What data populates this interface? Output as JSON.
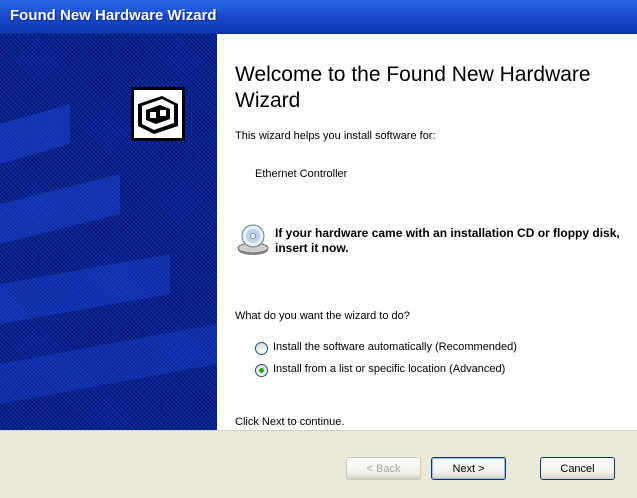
{
  "window": {
    "title": "Found New Hardware Wizard"
  },
  "sidebar": {
    "icon": "hardware-card-icon"
  },
  "content": {
    "heading": "Welcome to the Found New Hardware Wizard",
    "intro": "This wizard helps you install software for:",
    "device_name": "Ethernet Controller",
    "cd_icon": "cd-disk-icon",
    "cd_prompt": "If your hardware came with an installation CD or floppy disk, insert it now.",
    "question": "What do you want the wizard to do?",
    "options": [
      {
        "label": "Install the software automatically (Recommended)",
        "selected": false
      },
      {
        "label": "Install from a list or specific location (Advanced)",
        "selected": true
      }
    ],
    "continue_text": "Click Next to continue."
  },
  "buttons": {
    "back": "< Back",
    "next": "Next >",
    "cancel": "Cancel"
  },
  "colors": {
    "titlebar": "#1747c8",
    "sidebar": "#0c2fb4",
    "footer": "#ece9d8",
    "radio_selected": "#21a121"
  }
}
